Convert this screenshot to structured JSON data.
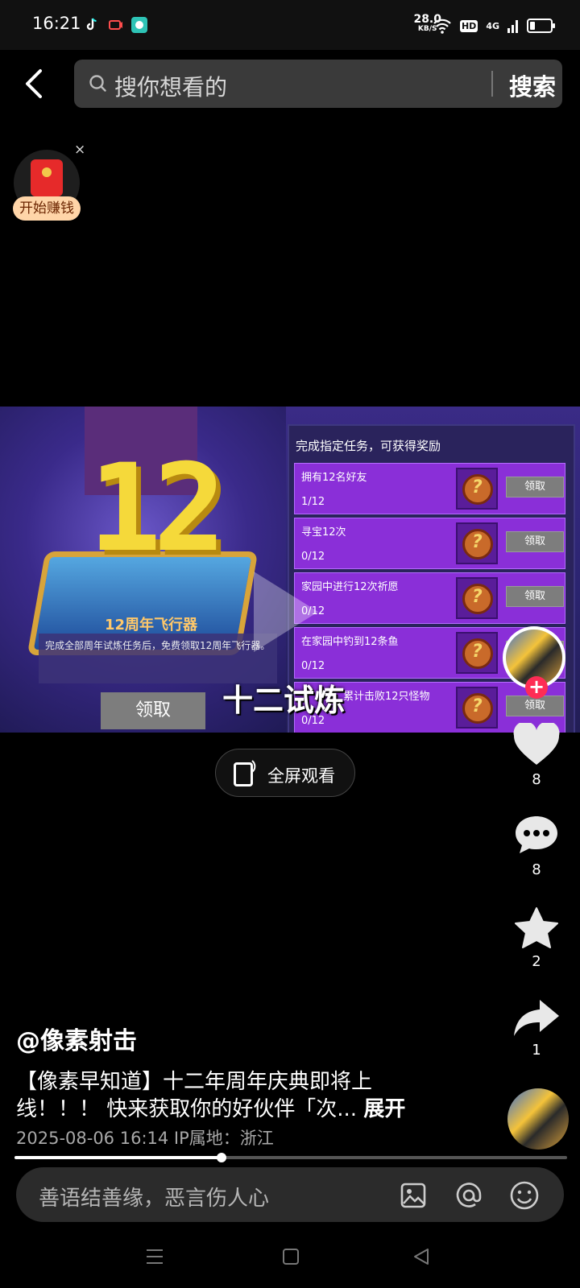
{
  "status_bar": {
    "time": "16:21",
    "net_speed": "28.0",
    "net_unit": "KB/S",
    "hd_badge": "HD",
    "network": "4G",
    "battery_level": 0.25
  },
  "search": {
    "placeholder": "搜你想看的",
    "button": "搜索"
  },
  "red_packet": {
    "label": "开始赚钱",
    "close": "×"
  },
  "video": {
    "vehicle_title": "12周年飞行器",
    "vehicle_desc": "完成全部周年试炼任务后，免费领取12周年飞行器。",
    "claim_button": "领取",
    "tasks_header": "完成指定任务，可获得奖励",
    "tasks": [
      {
        "name": "拥有12名好友",
        "progress": "1/12",
        "claim": "领取"
      },
      {
        "name": "寻宝12次",
        "progress": "0/12",
        "claim": "领取"
      },
      {
        "name": "家园中进行12次祈愿",
        "progress": "0/12",
        "claim": "领取"
      },
      {
        "name": "在家园中钓到12条鱼",
        "progress": "0/12",
        "claim": "领取"
      },
      {
        "name": "累计击败12只怪物",
        "progress": "0/12",
        "claim": "领取"
      }
    ],
    "subtitle": "十二试炼"
  },
  "fullscreen": {
    "label": "全屏观看"
  },
  "rail": {
    "like_count": "8",
    "comment_count": "8",
    "favorite_count": "2",
    "share_count": "1",
    "like_color": "#e8e8e8"
  },
  "post": {
    "author": "@像素射击",
    "desc_line1": "【像素早知道】十二年周年庆典即将上",
    "desc_line2": "线！！！ 快来获取你的好伙伴「次... ",
    "expand": "展开",
    "meta": "2025-08-06 16:14  IP属地：浙江",
    "progress": 0.375
  },
  "comment": {
    "placeholder": "善语结善缘，恶言伤人心"
  }
}
